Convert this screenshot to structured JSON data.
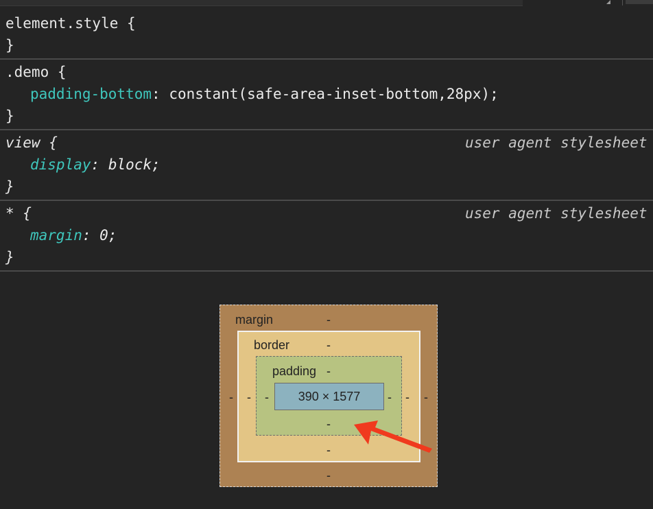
{
  "rules": [
    {
      "selector": "element.style {",
      "close": "}",
      "declarations": []
    },
    {
      "selector": ".demo {",
      "close": "}",
      "declarations": [
        {
          "property": "padding-bottom",
          "value": "constant(safe-area-inset-bottom,28px);"
        }
      ]
    },
    {
      "selector": "view {",
      "close": "}",
      "origin": "user agent stylesheet",
      "declarations": [
        {
          "property": "display",
          "value": "block;"
        }
      ]
    },
    {
      "selector": "* {",
      "close": "}",
      "origin": "user agent stylesheet",
      "declarations": [
        {
          "property": "margin",
          "value": "0;"
        }
      ]
    }
  ],
  "box_model": {
    "margin_label": "margin",
    "border_label": "border",
    "padding_label": "padding",
    "content_size": "390 × 1577",
    "margin": {
      "top": "-",
      "right": "-",
      "bottom": "-",
      "left": "-"
    },
    "border": {
      "top": "-",
      "right": "-",
      "bottom": "-",
      "left": "-"
    },
    "padding": {
      "top": "-",
      "right": "-",
      "bottom": "-",
      "left": "-"
    }
  },
  "colors": {
    "background": "#242424",
    "property": "#3fc7bd",
    "margin_box": "#ad8253",
    "border_box": "#e3c585",
    "padding_box": "#b7c381",
    "content_box": "#8cb2bf",
    "annotation_arrow": "#f03a1e"
  },
  "icons": [
    "corner-resize-icon",
    "red-annotation-arrow"
  ]
}
